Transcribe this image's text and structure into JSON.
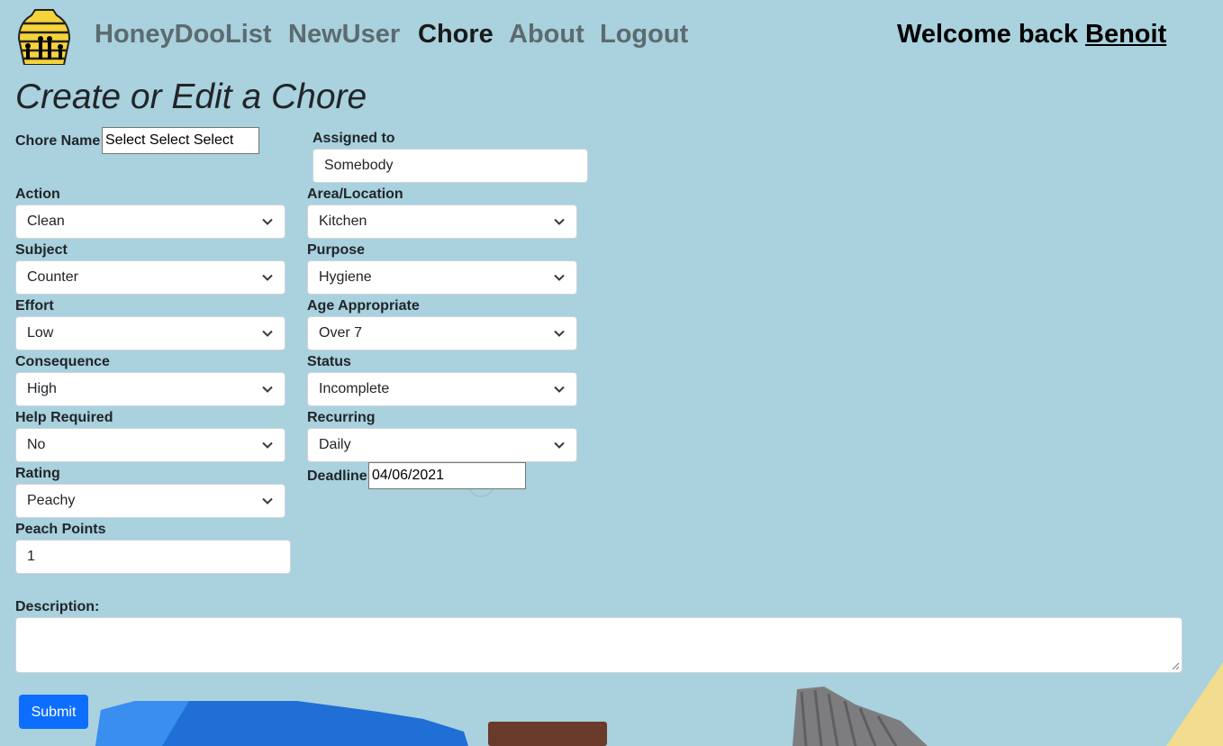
{
  "nav": {
    "brand": "HoneyDooList",
    "links": [
      "NewUser",
      "Chore",
      "About",
      "Logout"
    ],
    "active": "Chore",
    "welcome_prefix": "Welcome back",
    "username": "Benoit"
  },
  "page_title": "Create or Edit a Chore",
  "form": {
    "chore_name": {
      "label": "Chore Name",
      "value": "Select Select Select"
    },
    "assigned_to": {
      "label": "Assigned to",
      "value": "Somebody"
    },
    "action": {
      "label": "Action",
      "value": "Clean"
    },
    "area": {
      "label": "Area/Location",
      "value": "Kitchen"
    },
    "subject": {
      "label": "Subject",
      "value": "Counter"
    },
    "purpose": {
      "label": "Purpose",
      "value": "Hygiene"
    },
    "effort": {
      "label": "Effort",
      "value": "Low"
    },
    "age": {
      "label": "Age Appropriate",
      "value": "Over 7"
    },
    "consequence": {
      "label": "Consequence",
      "value": "High"
    },
    "status": {
      "label": "Status",
      "value": "Incomplete"
    },
    "help": {
      "label": "Help Required",
      "value": "No"
    },
    "recurring": {
      "label": "Recurring",
      "value": "Daily"
    },
    "rating": {
      "label": "Rating",
      "value": "Peachy"
    },
    "deadline": {
      "label": "Deadline",
      "value": "04/06/2021"
    },
    "peach_points": {
      "label": "Peach Points",
      "value": "1"
    },
    "description": {
      "label": "Description:",
      "value": ""
    },
    "submit_label": "Submit"
  },
  "colors": {
    "background": "#a9d1de",
    "primary_button": "#0d6efd",
    "nav_link": "#5c6b70",
    "logo_yellow": "#f5d33a"
  },
  "icons": {
    "logo": "beehive-family-logo",
    "select_arrow": "chevron-down-icon"
  }
}
